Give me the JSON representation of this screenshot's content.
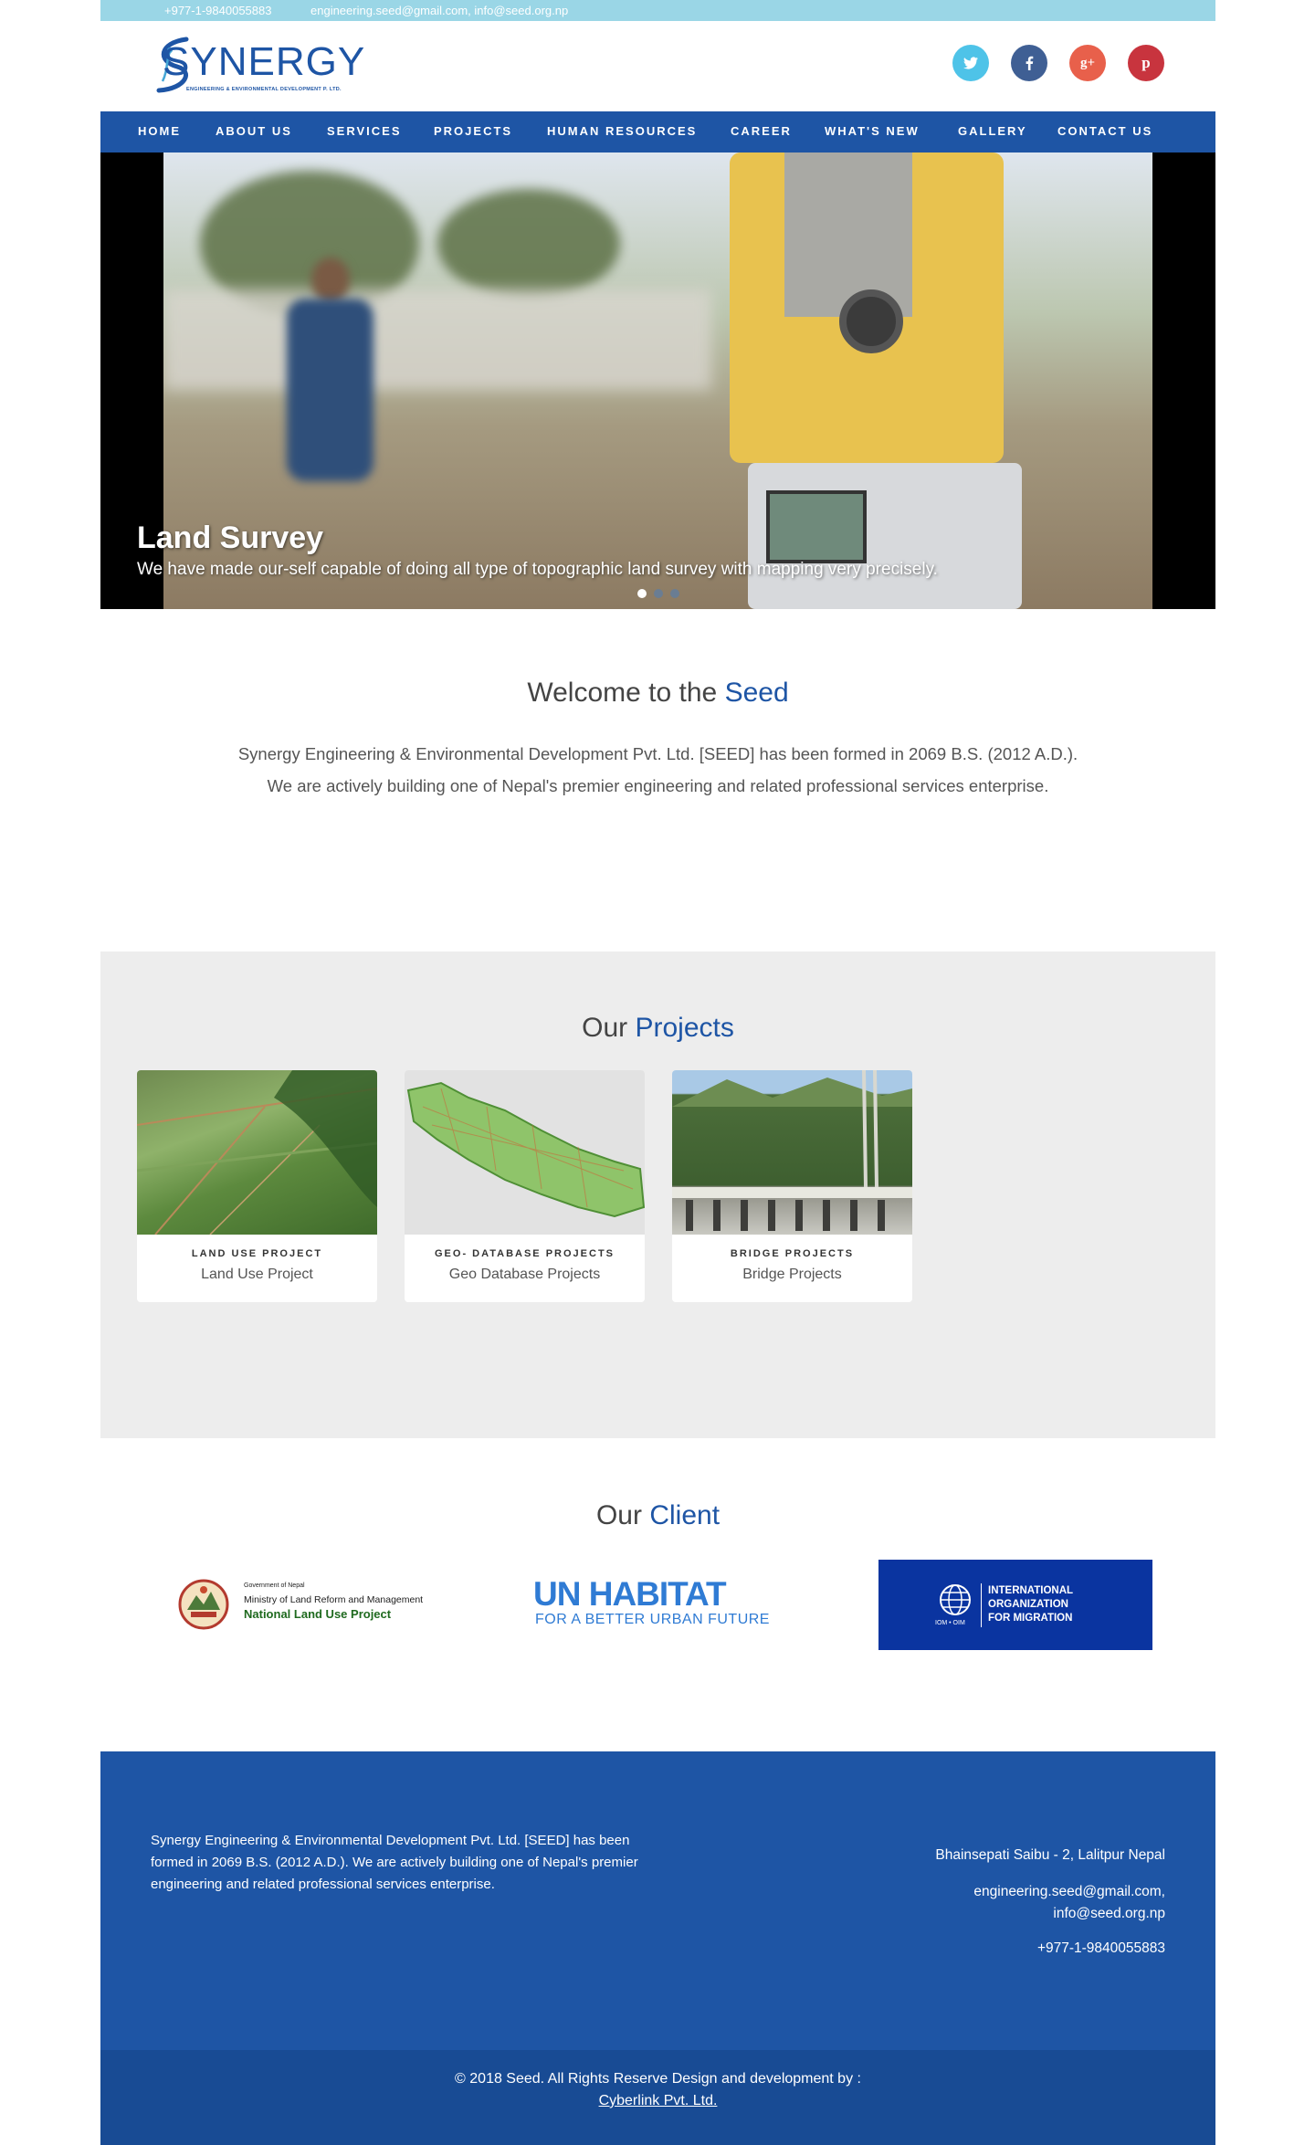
{
  "topbar": {
    "phone": "+977-1-9840055883",
    "emails": "engineering.seed@gmail.com, info@seed.org.np"
  },
  "logo": {
    "brand": "SYNERGY",
    "tagline": "ENGINEERING & ENVIRONMENTAL DEVELOPMENT P. LTD."
  },
  "social": [
    {
      "icon": "twitter-icon",
      "glyph": "t",
      "color": "#4ec3e8"
    },
    {
      "icon": "facebook-icon",
      "glyph": "f",
      "color": "#3f5f94"
    },
    {
      "icon": "google-plus-icon",
      "glyph": "g+",
      "color": "#e8604b"
    },
    {
      "icon": "pinterest-icon",
      "glyph": "p",
      "color": "#c8343e"
    }
  ],
  "nav": [
    "HOME",
    "ABOUT US",
    "SERVICES",
    "PROJECTS",
    "HUMAN RESOURCES",
    "CAREER",
    "WHAT'S NEW",
    "GALLERY",
    "CONTACT US"
  ],
  "slider": {
    "title": "Land Survey",
    "text": "We have made our-self capable of doing all type of topographic land survey with mapping very precisely.",
    "slide_count": 3,
    "active_slide": 1
  },
  "welcome": {
    "title_prefix": "Welcome to the",
    "title_accent": "Seed",
    "text": "Synergy Engineering & Environmental Development Pvt. Ltd. [SEED] has been formed in 2069 B.S. (2012 A.D.). We are actively building one of Nepal's premier engineering and related professional services enterprise."
  },
  "projects": {
    "title_prefix": "Our",
    "title_accent": "Projects",
    "items": [
      {
        "category": "LAND USE PROJECT",
        "name": "Land Use Project"
      },
      {
        "category": "GEO- DATABASE PROJECTS",
        "name": "Geo Database Projects"
      },
      {
        "category": "BRIDGE PROJECTS",
        "name": "Bridge Projects"
      }
    ]
  },
  "clients": {
    "title_prefix": "Our",
    "title_accent": "Client",
    "nlup": {
      "line1": "Government of Nepal",
      "line2": "Ministry of Land Reform and Management",
      "line3": "National Land Use Project"
    },
    "unhabitat": {
      "main": "UN HABITAT",
      "sub": "FOR A BETTER URBAN FUTURE"
    },
    "iom": {
      "line1": "INTERNATIONAL",
      "line2": "ORGANIZATION",
      "line3": "FOR MIGRATION",
      "abbr": "IOM • OIM"
    }
  },
  "footer": {
    "about": "Synergy Engineering & Environmental Development Pvt. Ltd. [SEED] has been formed in 2069 B.S. (2012 A.D.). We are actively building one of Nepal's premier engineering and related professional services enterprise.",
    "address": "Bhainsepati Saibu - 2, Lalitpur Nepal",
    "email1": "engineering.seed@gmail.com,",
    "email2": "info@seed.org.np",
    "phone": "+977-1-9840055883",
    "copyright": "© 2018 Seed. All Rights Reserve Design and development by :",
    "credit": "Cyberlink Pvt. Ltd."
  },
  "colors": {
    "brand_blue": "#1e55a5",
    "topbar": "#9ad6e6",
    "projects_bg": "#ededed"
  }
}
